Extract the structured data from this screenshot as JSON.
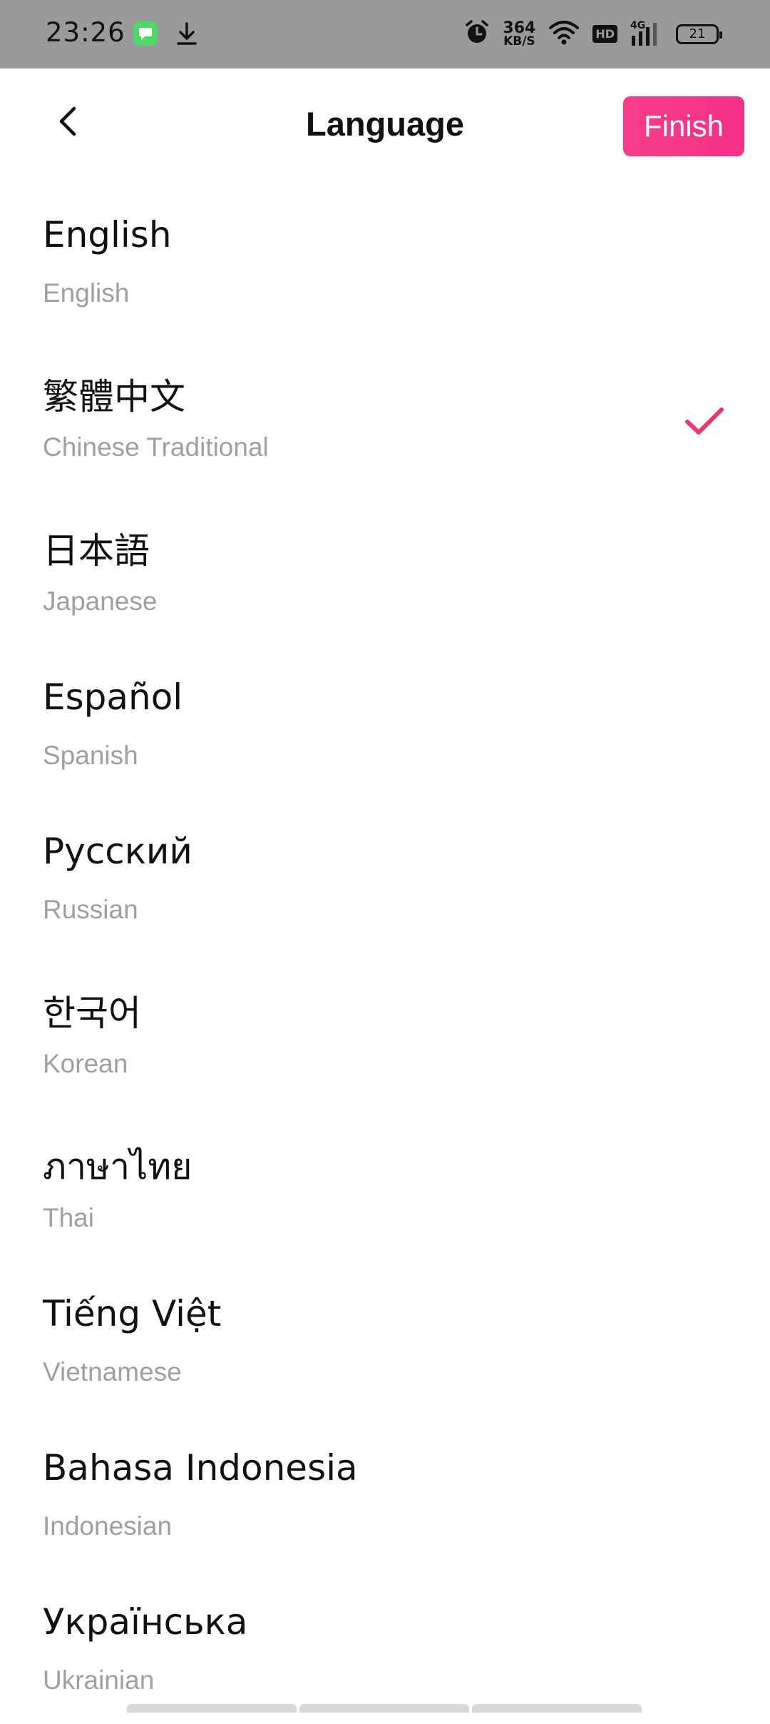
{
  "status_bar": {
    "time": "23:26",
    "net_speed_value": "364",
    "net_speed_unit": "KB/S",
    "hd_label": "HD",
    "network_type": "4G",
    "battery": "21",
    "icons": [
      "message-app-icon",
      "download-icon",
      "alarm-icon",
      "wifi-icon",
      "hd-icon",
      "signal-icon",
      "battery-icon"
    ]
  },
  "header": {
    "title": "Language",
    "finish_label": "Finish"
  },
  "colors": {
    "accent": "#f5358a",
    "secondary_text": "#a0a0a0",
    "status_bar_bg": "#9a9a9a"
  },
  "languages": [
    {
      "native": "English",
      "english": "English",
      "selected": false
    },
    {
      "native": "繁體中文",
      "english": "Chinese Traditional",
      "selected": true
    },
    {
      "native": "日本語",
      "english": "Japanese",
      "selected": false
    },
    {
      "native": "Español",
      "english": "Spanish",
      "selected": false
    },
    {
      "native": "Русский",
      "english": "Russian",
      "selected": false
    },
    {
      "native": "한국어",
      "english": "Korean",
      "selected": false
    },
    {
      "native": "ภาษาไทย",
      "english": "Thai",
      "selected": false
    },
    {
      "native": "Tiếng Việt",
      "english": "Vietnamese",
      "selected": false
    },
    {
      "native": "Bahasa Indonesia",
      "english": "Indonesian",
      "selected": false
    },
    {
      "native": "Українська",
      "english": "Ukrainian",
      "selected": false
    }
  ]
}
